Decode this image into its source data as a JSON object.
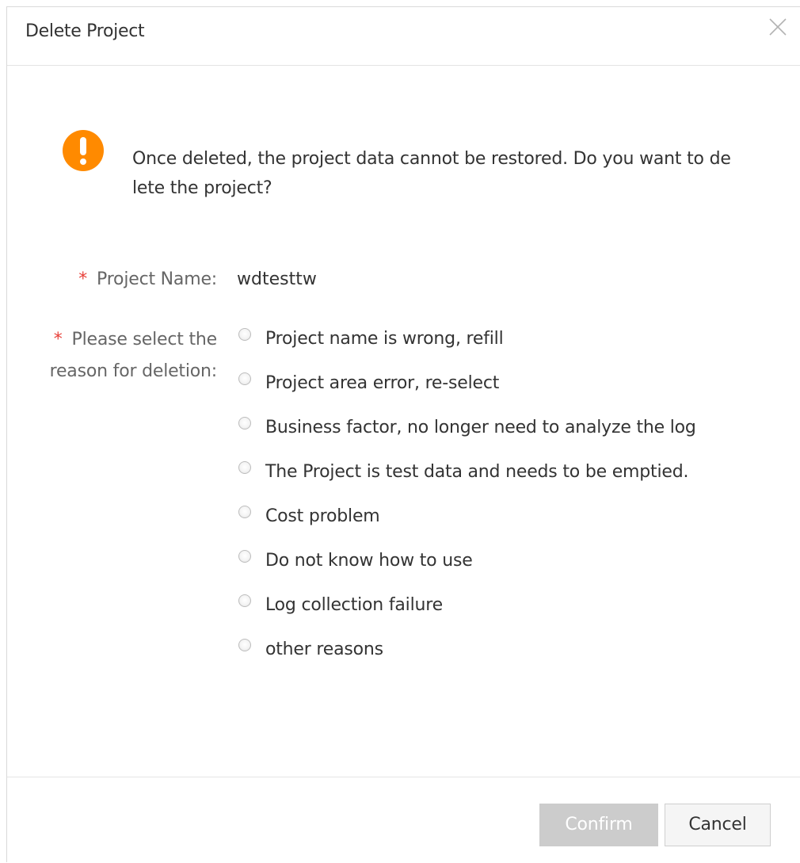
{
  "dialog": {
    "title": "Delete Project",
    "close_icon": "close-icon"
  },
  "warning": {
    "icon": "warning-icon",
    "icon_color": "#ff8a00",
    "message": "Once deleted, the project data cannot be restored. Do you want to delete the project?"
  },
  "form": {
    "required_mark": "*",
    "required_color": "#e8413a",
    "project_name_label": "Project Name:",
    "project_name_value": "wdtesttw",
    "reason_label": "Please select the reason for deletion:",
    "reasons": [
      "Project name is wrong, refill",
      "Project area error, re-select",
      "Business factor, no longer need to analyze the log",
      "The Project is test data and needs to be emptied.",
      "Cost problem",
      "Do not know how to use",
      "Log collection failure",
      "other reasons"
    ],
    "selected_reason": null
  },
  "footer": {
    "confirm_label": "Confirm",
    "confirm_disabled": true,
    "cancel_label": "Cancel"
  }
}
